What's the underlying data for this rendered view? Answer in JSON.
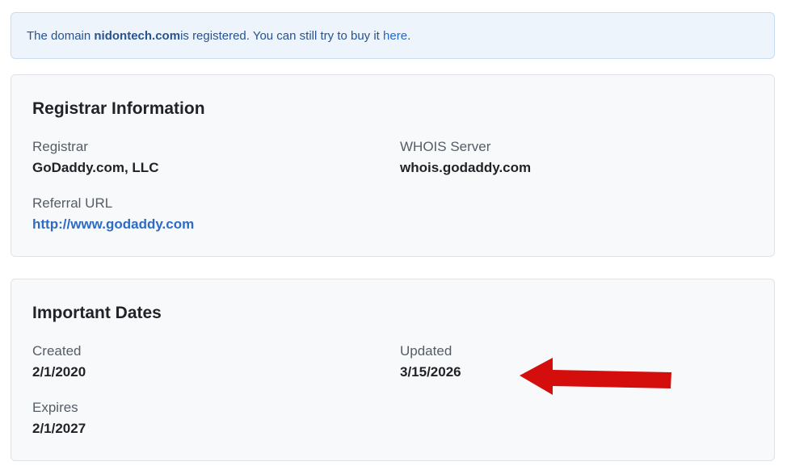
{
  "notice": {
    "prefix": "The domain ",
    "domain": "nidontech.com",
    "middle": " is registered. You can still try to buy it ",
    "link_text": "here",
    "suffix": "."
  },
  "registrar": {
    "title": "Registrar Information",
    "registrar_label": "Registrar",
    "registrar_value": "GoDaddy.com, LLC",
    "whois_label": "WHOIS Server",
    "whois_value": "whois.godaddy.com",
    "referral_label": "Referral URL",
    "referral_value": "http://www.godaddy.com"
  },
  "dates": {
    "title": "Important Dates",
    "created_label": "Created",
    "created_value": "2/1/2020",
    "updated_label": "Updated",
    "updated_value": "3/15/2026",
    "expires_label": "Expires",
    "expires_value": "2/1/2027"
  },
  "annotation": {
    "arrow_color": "#d40d0d",
    "arrow_icon": "red-arrow-left-icon"
  },
  "colors": {
    "notice_bg": "#edf4fc",
    "link": "#2d6bc4",
    "card_bg": "#f8f9fb"
  }
}
